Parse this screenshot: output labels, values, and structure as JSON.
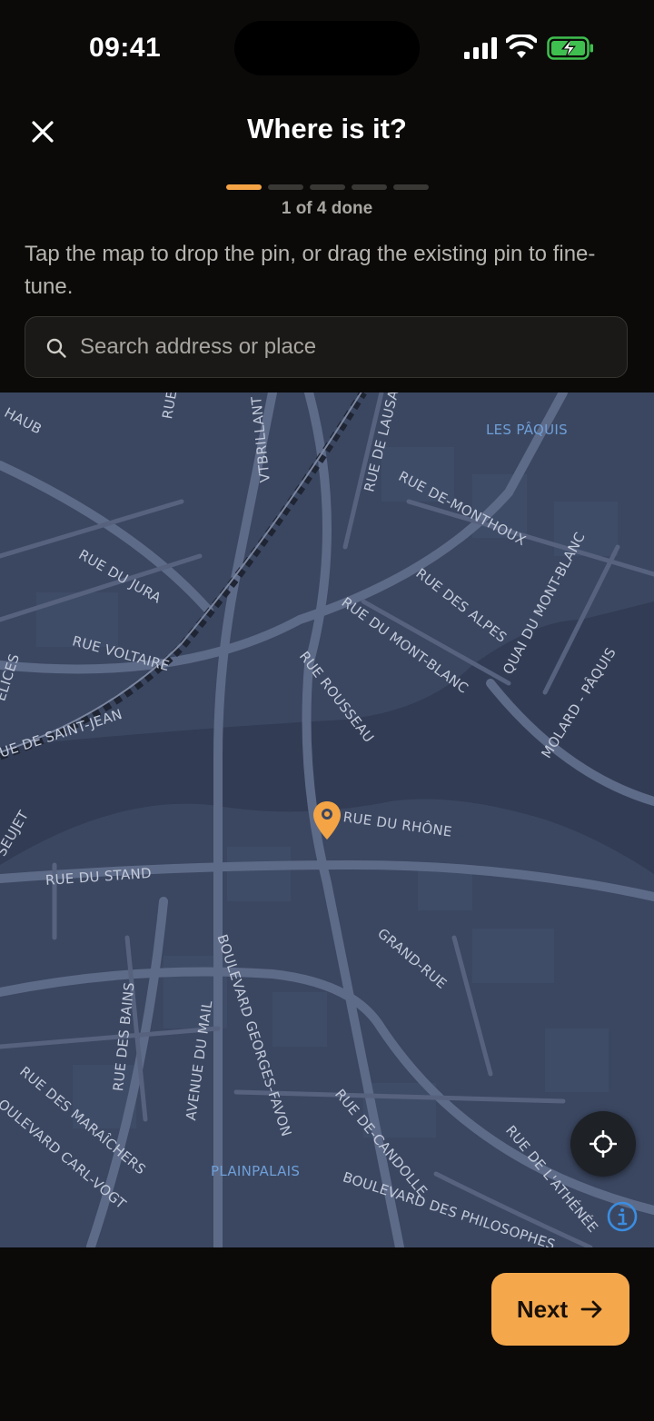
{
  "status_bar": {
    "time": "09:41",
    "icons": [
      "cellular-signal-icon",
      "wifi-icon",
      "battery-charging-icon"
    ]
  },
  "header": {
    "title": "Where is it?",
    "close_icon": "close-icon"
  },
  "progress": {
    "current_step": 1,
    "total_steps": 5,
    "label": "1 of 4 done"
  },
  "instruction": "Tap the map to drop the pin, or drag the existing pin to fine-tune.",
  "search": {
    "placeholder": "Search address or place",
    "value": "",
    "icon": "search-icon"
  },
  "map": {
    "labels": {
      "haub": "HAUB",
      "rue_de_lausanne": "RUE DE LAUSA",
      "rue_lu": "RUE",
      "avantbrillant": "VTBRILLANT",
      "les_paquis": "LES PÂQUIS",
      "rue_de_montheux": "RUE DE-MONTHOUX",
      "rue_du_jura": "RUE DU JURA",
      "rue_des_alpes": "RUE DES ALPES",
      "quai_du_mont_blanc": "QUAI DU MONT-BLANC",
      "rue_voltaire": "RUE VOLTAIRE",
      "rue_du_mont_blanc": "RUE DU MONT-BLANC",
      "delices": "ÉLICES",
      "rue_rousseau": "RUE ROUSSEAU",
      "molard_paquis": "MOLARD - PÂQUIS",
      "rue_de_saint_jean": "UE DE SAINT-JEAN",
      "seujet": "SEUJET",
      "rue_du_rhone": "RUE DU RHÔNE",
      "rue_du_stand": "RUE DU STAND",
      "grand_rue": "GRAND-RUE",
      "boulevard_georges_favon": "BOULEVARD GEORGES-FAVON",
      "rue_des_bains": "RUE DES BAINS",
      "avenue_du_mail": "AVENUE DU MAIL",
      "rue_des_maraichers": "RUE DES MARAÎCHERS",
      "boulevard_carl_vogt": "OULEVARD CARL-VOGT",
      "rue_de_candolle": "RUE DE-CANDOLLE",
      "rue_de_l_athenee": "RUE DE L'ATHÉNÉE",
      "plainpalais": "PLAINPALAIS",
      "boulevard_des_philosophes": "BOULEVARD DES PHILOSOPHES"
    },
    "pin_icon": "map-pin-icon",
    "locate_icon": "crosshair-icon",
    "info_icon": "info-icon",
    "colors": {
      "background": "#3b4761",
      "road": "#5e6b88",
      "water": "#323c54",
      "pin": "#f4a444"
    }
  },
  "footer": {
    "next_label": "Next",
    "next_icon": "arrow-right-icon"
  },
  "colors": {
    "accent": "#f5a84b",
    "background": "#0b0a09"
  }
}
